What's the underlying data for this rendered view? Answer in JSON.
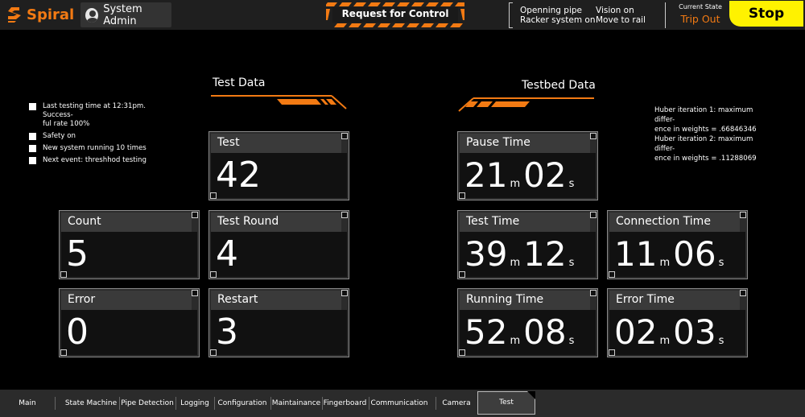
{
  "app": {
    "name": "Spiral",
    "accent": "#f27a13"
  },
  "user": {
    "name": "System Admin"
  },
  "control": {
    "request_label": "Request for Control"
  },
  "system_status": {
    "left_line1": "Openning pipe",
    "left_line2": "Racker system on",
    "right_line1": "Vision on",
    "right_line2": "Move to rail"
  },
  "current_state": {
    "label": "Current State",
    "value": "Trip Out"
  },
  "stop": {
    "label": "Stop",
    "color": "#fff200"
  },
  "checklist": [
    "Last testing time at 12:31pm. Success-",
    "ful rate 100%",
    "Safety on",
    "New system running 10 times",
    "Next event: threshhod testing"
  ],
  "huber": {
    "line1": "Huber iteration 1:  maximum differ-",
    "line2": "ence in weights = .66846346",
    "line3": "Huber iteration 2:  maximum differ-",
    "line4": "ence in weights = .11288069"
  },
  "test_data": {
    "title": "Test Data",
    "test": {
      "label": "Test",
      "value": "42"
    },
    "count": {
      "label": "Count",
      "value": "5"
    },
    "test_round": {
      "label": "Test Round",
      "value": "4"
    },
    "error": {
      "label": "Error",
      "value": "0"
    },
    "restart": {
      "label": "Restart",
      "value": "3"
    }
  },
  "testbed_data": {
    "title": "Testbed Data",
    "pause_time": {
      "label": "Pause Time",
      "min": "21",
      "sec": "02"
    },
    "test_time": {
      "label": "Test Time",
      "min": "39",
      "sec": "12"
    },
    "connection_time": {
      "label": "Connection Time",
      "min": "11",
      "sec": "06"
    },
    "running_time": {
      "label": "Running Time",
      "min": "52",
      "sec": "08"
    },
    "error_time": {
      "label": "Error Time",
      "min": "02",
      "sec": "03"
    },
    "unit_min": "m",
    "unit_sec": "s"
  },
  "nav": {
    "main": "Main",
    "state_machine": "State Machine",
    "pipe_detection": "Pipe Detection",
    "logging": "Logging",
    "configuration": "Configuration",
    "maintainance": "Maintainance",
    "fingerboard": "Fingerboard",
    "communication": "Communication",
    "camera": "Camera",
    "test": "Test",
    "active": "Test"
  }
}
